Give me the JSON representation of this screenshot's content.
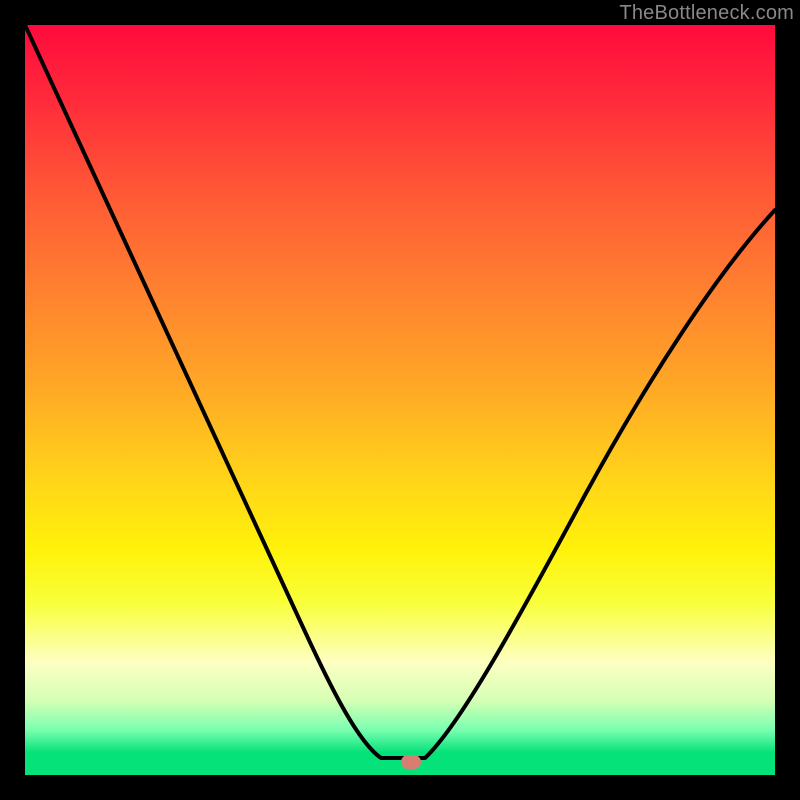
{
  "watermark": "TheBottleneck.com",
  "marker": {
    "x_pct": 51.5,
    "y_pct": 98.2
  },
  "chart_data": {
    "type": "line",
    "title": "",
    "xlabel": "",
    "ylabel": "",
    "xlim": [
      0,
      100
    ],
    "ylim": [
      0,
      100
    ],
    "grid": false,
    "legend": false,
    "annotations": [
      "TheBottleneck.com"
    ],
    "background_gradient": [
      "#ff0a3c",
      "#ff8030",
      "#fff20a",
      "#05e27a"
    ],
    "series": [
      {
        "name": "bottleneck-curve",
        "x": [
          0,
          5,
          10,
          15,
          20,
          24,
          28,
          32,
          36,
          40,
          43,
          46,
          48,
          50,
          52,
          54,
          56,
          60,
          64,
          68,
          72,
          76,
          80,
          84,
          88,
          92,
          96,
          100
        ],
        "y": [
          100,
          89,
          78,
          68,
          58,
          50,
          42,
          34,
          26,
          18,
          12,
          6,
          2.5,
          1.5,
          1.5,
          2.5,
          5,
          11,
          18,
          25,
          32,
          39,
          46,
          53,
          59,
          65,
          70,
          75
        ]
      }
    ],
    "marker_point": {
      "x": 51.5,
      "y": 1.8
    }
  }
}
